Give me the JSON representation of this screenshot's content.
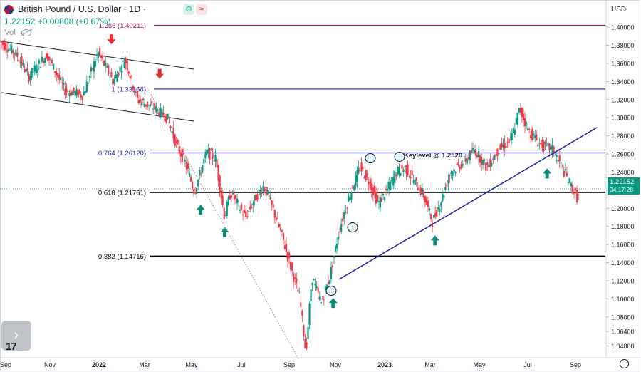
{
  "header": {
    "symbol": "British Pound / U.S. Dollar · 1D ·",
    "price": "1.22152",
    "change": "+0.00808 (+0.67%)",
    "volume_label": "Vol",
    "currency": "USD"
  },
  "last_price_tag": {
    "price": "1.22152",
    "countdown": "04:17:28"
  },
  "colors": {
    "up": "#089981",
    "down": "#f23645",
    "accent_line": "#1e22aa",
    "magenta": "#b3145a"
  },
  "chart_data": {
    "type": "candlestick",
    "title": "British Pound / U.S. Dollar · 1D",
    "x_ticks": [
      "Sep",
      "Nov",
      "2022",
      "Mar",
      "May",
      "Jul",
      "Sep",
      "Nov",
      "2023",
      "Mar",
      "May",
      "Jul",
      "Sep"
    ],
    "y_ticks": [
      "1.40000",
      "1.38000",
      "1.36000",
      "1.34000",
      "1.32000",
      "1.30000",
      "1.28000",
      "1.26000",
      "1.24000",
      "1.22000",
      "1.20000",
      "1.18000",
      "1.16000",
      "1.14000",
      "1.12000",
      "1.10000",
      "1.08000",
      "1.06400",
      "1.04800"
    ],
    "ylim": [
      1.035,
      1.43
    ],
    "fib_levels": [
      {
        "label": "1.236 (1.40211)",
        "value": 1.40211,
        "color": "#b3145a"
      },
      {
        "label": "1 (1.33168)",
        "value": 1.33168,
        "color": "#1e22aa"
      },
      {
        "label": "0.764 (1.26120)",
        "value": 1.2612,
        "color": "#1e22aa"
      },
      {
        "label": "0.618 (1.21761)",
        "value": 1.21761,
        "color": "#000000"
      },
      {
        "label": "0.382 (1.14716)",
        "value": 1.14716,
        "color": "#000000"
      }
    ],
    "annotation": "Keylevel @ 1.2520",
    "price_path": [
      [
        0,
        1.385
      ],
      [
        0.03,
        1.37
      ],
      [
        0.05,
        1.345
      ],
      [
        0.08,
        1.37
      ],
      [
        0.11,
        1.33
      ],
      [
        0.14,
        1.325
      ],
      [
        0.165,
        1.372
      ],
      [
        0.19,
        1.34
      ],
      [
        0.21,
        1.365
      ],
      [
        0.23,
        1.32
      ],
      [
        0.26,
        1.31
      ],
      [
        0.28,
        1.3
      ],
      [
        0.295,
        1.27
      ],
      [
        0.31,
        1.25
      ],
      [
        0.325,
        1.218
      ],
      [
        0.345,
        1.262
      ],
      [
        0.36,
        1.255
      ],
      [
        0.375,
        1.19
      ],
      [
        0.385,
        1.218
      ],
      [
        0.41,
        1.19
      ],
      [
        0.425,
        1.21
      ],
      [
        0.44,
        1.225
      ],
      [
        0.455,
        1.2
      ],
      [
        0.47,
        1.17
      ],
      [
        0.485,
        1.135
      ],
      [
        0.5,
        1.1
      ],
      [
        0.51,
        1.04
      ],
      [
        0.52,
        1.125
      ],
      [
        0.535,
        1.095
      ],
      [
        0.55,
        1.125
      ],
      [
        0.565,
        1.175
      ],
      [
        0.58,
        1.21
      ],
      [
        0.6,
        1.245
      ],
      [
        0.615,
        1.23
      ],
      [
        0.63,
        1.205
      ],
      [
        0.645,
        1.22
      ],
      [
        0.66,
        1.24
      ],
      [
        0.675,
        1.245
      ],
      [
        0.69,
        1.23
      ],
      [
        0.705,
        1.215
      ],
      [
        0.72,
        1.185
      ],
      [
        0.735,
        1.21
      ],
      [
        0.75,
        1.24
      ],
      [
        0.77,
        1.25
      ],
      [
        0.79,
        1.265
      ],
      [
        0.81,
        1.245
      ],
      [
        0.83,
        1.265
      ],
      [
        0.85,
        1.275
      ],
      [
        0.865,
        1.31
      ],
      [
        0.88,
        1.285
      ],
      [
        0.9,
        1.27
      ],
      [
        0.92,
        1.265
      ],
      [
        0.935,
        1.245
      ],
      [
        0.95,
        1.225
      ],
      [
        0.96,
        1.212
      ]
    ],
    "up_arrows": [
      [
        0.333,
        1.204
      ],
      [
        0.373,
        1.179
      ],
      [
        0.553,
        1.101
      ],
      [
        0.722,
        1.17
      ],
      [
        0.908,
        1.244
      ]
    ],
    "down_arrows": [
      [
        0.185,
        1.381
      ],
      [
        0.265,
        1.343
      ]
    ]
  }
}
